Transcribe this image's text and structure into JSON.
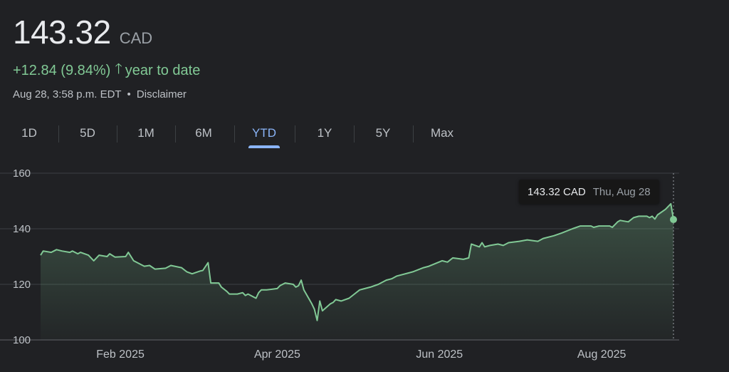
{
  "quote": {
    "price": "143.32",
    "currency": "CAD",
    "change": "+12.84 (9.84%)",
    "change_period": "year to date",
    "timestamp": "Aug 28, 3:58 p.m. EDT",
    "separator": "•",
    "disclaimer": "Disclaimer"
  },
  "icons": {
    "up_arrow": "🡑"
  },
  "tabs": [
    "1D",
    "5D",
    "1M",
    "6M",
    "YTD",
    "1Y",
    "5Y",
    "Max"
  ],
  "active_tab": "YTD",
  "tooltip": {
    "value": "143.32 CAD",
    "date": "Thu, Aug 28"
  },
  "colors": {
    "positive": "#81c995",
    "accent": "#8ab4f8",
    "line": "#81c995",
    "background": "#202124"
  },
  "chart_data": {
    "type": "area",
    "title": "",
    "xlabel": "",
    "ylabel": "",
    "ylim": [
      100,
      160
    ],
    "yticks": [
      100,
      120,
      140,
      160
    ],
    "xticks": [
      {
        "label": "Feb 2025",
        "x": "2025-02-01"
      },
      {
        "label": "Apr 2025",
        "x": "2025-04-01"
      },
      {
        "label": "Jun 2025",
        "x": "2025-06-01"
      },
      {
        "label": "Aug 2025",
        "x": "2025-08-01"
      }
    ],
    "xlim": [
      "2025-01-02",
      "2025-08-28"
    ],
    "grid": true,
    "series": [
      {
        "points": [
          [
            "2025-01-02",
            130.5
          ],
          [
            "2025-01-03",
            132.0
          ],
          [
            "2025-01-06",
            131.5
          ],
          [
            "2025-01-07",
            132.0
          ],
          [
            "2025-01-08",
            132.5
          ],
          [
            "2025-01-10",
            132.0
          ],
          [
            "2025-01-13",
            131.5
          ],
          [
            "2025-01-14",
            132.0
          ],
          [
            "2025-01-16",
            131.0
          ],
          [
            "2025-01-17",
            131.5
          ],
          [
            "2025-01-20",
            130.5
          ],
          [
            "2025-01-22",
            128.5
          ],
          [
            "2025-01-24",
            130.5
          ],
          [
            "2025-01-27",
            130.0
          ],
          [
            "2025-01-28",
            131.0
          ],
          [
            "2025-01-30",
            129.8
          ],
          [
            "2025-02-03",
            130.0
          ],
          [
            "2025-02-04",
            131.5
          ],
          [
            "2025-02-06",
            128.5
          ],
          [
            "2025-02-10",
            126.5
          ],
          [
            "2025-02-12",
            126.8
          ],
          [
            "2025-02-14",
            125.5
          ],
          [
            "2025-02-18",
            125.8
          ],
          [
            "2025-02-20",
            126.8
          ],
          [
            "2025-02-24",
            126.0
          ],
          [
            "2025-02-26",
            124.5
          ],
          [
            "2025-02-28",
            123.8
          ],
          [
            "2025-03-03",
            124.8
          ],
          [
            "2025-03-04",
            125.0
          ],
          [
            "2025-03-06",
            127.8
          ],
          [
            "2025-03-07",
            120.5
          ],
          [
            "2025-03-10",
            120.5
          ],
          [
            "2025-03-11",
            119.0
          ],
          [
            "2025-03-13",
            117.5
          ],
          [
            "2025-03-14",
            116.5
          ],
          [
            "2025-03-17",
            116.5
          ],
          [
            "2025-03-19",
            117.0
          ],
          [
            "2025-03-20",
            116.0
          ],
          [
            "2025-03-21",
            116.5
          ],
          [
            "2025-03-24",
            115.0
          ],
          [
            "2025-03-25",
            117.0
          ],
          [
            "2025-03-26",
            118.0
          ],
          [
            "2025-03-28",
            118.0
          ],
          [
            "2025-04-01",
            118.5
          ],
          [
            "2025-04-02",
            119.5
          ],
          [
            "2025-04-04",
            120.5
          ],
          [
            "2025-04-07",
            120.0
          ],
          [
            "2025-04-08",
            119.0
          ],
          [
            "2025-04-09",
            119.5
          ],
          [
            "2025-04-10",
            121.5
          ],
          [
            "2025-04-11",
            118.0
          ],
          [
            "2025-04-14",
            113.0
          ],
          [
            "2025-04-15",
            111.0
          ],
          [
            "2025-04-16",
            107.0
          ],
          [
            "2025-04-17",
            114.0
          ],
          [
            "2025-04-18",
            110.5
          ],
          [
            "2025-04-21",
            113.0
          ],
          [
            "2025-04-22",
            113.5
          ],
          [
            "2025-04-23",
            114.5
          ],
          [
            "2025-04-25",
            114.0
          ],
          [
            "2025-04-28",
            115.0
          ],
          [
            "2025-04-30",
            116.5
          ],
          [
            "2025-05-02",
            118.0
          ],
          [
            "2025-05-06",
            119.0
          ],
          [
            "2025-05-09",
            120.0
          ],
          [
            "2025-05-12",
            121.5
          ],
          [
            "2025-05-14",
            122.0
          ],
          [
            "2025-05-16",
            123.0
          ],
          [
            "2025-05-20",
            124.0
          ],
          [
            "2025-05-22",
            124.5
          ],
          [
            "2025-05-26",
            126.0
          ],
          [
            "2025-05-28",
            126.5
          ],
          [
            "2025-06-02",
            128.5
          ],
          [
            "2025-06-04",
            128.0
          ],
          [
            "2025-06-06",
            129.5
          ],
          [
            "2025-06-10",
            129.0
          ],
          [
            "2025-06-12",
            129.5
          ],
          [
            "2025-06-13",
            134.5
          ],
          [
            "2025-06-16",
            133.5
          ],
          [
            "2025-06-17",
            135.0
          ],
          [
            "2025-06-18",
            133.5
          ],
          [
            "2025-06-20",
            134.0
          ],
          [
            "2025-06-23",
            134.5
          ],
          [
            "2025-06-25",
            134.0
          ],
          [
            "2025-06-27",
            135.0
          ],
          [
            "2025-07-01",
            135.5
          ],
          [
            "2025-07-04",
            136.0
          ],
          [
            "2025-07-08",
            135.5
          ],
          [
            "2025-07-10",
            136.5
          ],
          [
            "2025-07-14",
            137.5
          ],
          [
            "2025-07-17",
            138.5
          ],
          [
            "2025-07-21",
            140.0
          ],
          [
            "2025-07-24",
            141.0
          ],
          [
            "2025-07-28",
            141.0
          ],
          [
            "2025-07-29",
            140.5
          ],
          [
            "2025-07-31",
            141.0
          ],
          [
            "2025-08-04",
            141.0
          ],
          [
            "2025-08-05",
            140.5
          ],
          [
            "2025-08-07",
            142.5
          ],
          [
            "2025-08-08",
            143.0
          ],
          [
            "2025-08-11",
            142.5
          ],
          [
            "2025-08-13",
            144.0
          ],
          [
            "2025-08-15",
            144.5
          ],
          [
            "2025-08-18",
            144.5
          ],
          [
            "2025-08-19",
            144.0
          ],
          [
            "2025-08-20",
            144.5
          ],
          [
            "2025-08-21",
            143.5
          ],
          [
            "2025-08-22",
            145.0
          ],
          [
            "2025-08-25",
            147.0
          ],
          [
            "2025-08-27",
            149.0
          ],
          [
            "2025-08-28",
            143.32
          ]
        ]
      }
    ],
    "highlight": {
      "x": "2025-08-28",
      "y": 143.32
    }
  }
}
